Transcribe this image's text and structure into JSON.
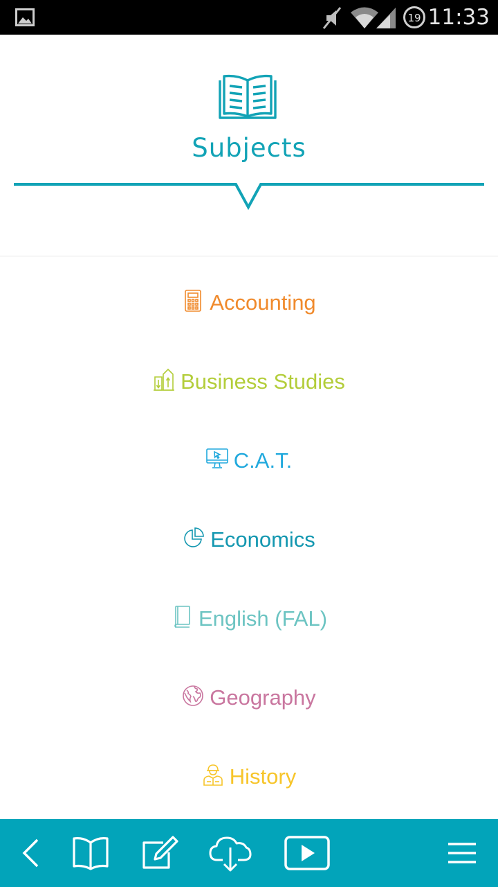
{
  "status_bar": {
    "time": "11:33",
    "notification_badge": "19",
    "icons": [
      "image-notification-icon",
      "mute-icon",
      "wifi-icon",
      "signal-icon",
      "sync-badge-icon"
    ]
  },
  "header": {
    "title": "Subjects",
    "icon": "open-book-icon",
    "accent_color": "#12a3b6"
  },
  "subjects": [
    {
      "label": "Accounting",
      "icon": "calculator-icon",
      "color": "#f08a2c"
    },
    {
      "label": "Business Studies",
      "icon": "buildings-icon",
      "color": "#b3cd3a"
    },
    {
      "label": "C.A.T.",
      "icon": "monitor-icon",
      "color": "#21a9dd"
    },
    {
      "label": "Economics",
      "icon": "pie-chart-icon",
      "color": "#1397b0"
    },
    {
      "label": "English (FAL)",
      "icon": "book-icon",
      "color": "#6cc4c2"
    },
    {
      "label": "Geography",
      "icon": "globe-icon",
      "color": "#c9769f"
    },
    {
      "label": "History",
      "icon": "historical-figure-icon",
      "color": "#f7c52a"
    }
  ],
  "bottom_bar": {
    "background": "#02a4ba",
    "buttons": [
      "back-icon",
      "book-icon",
      "edit-icon",
      "cloud-download-icon",
      "play-icon",
      "menu-icon"
    ]
  }
}
